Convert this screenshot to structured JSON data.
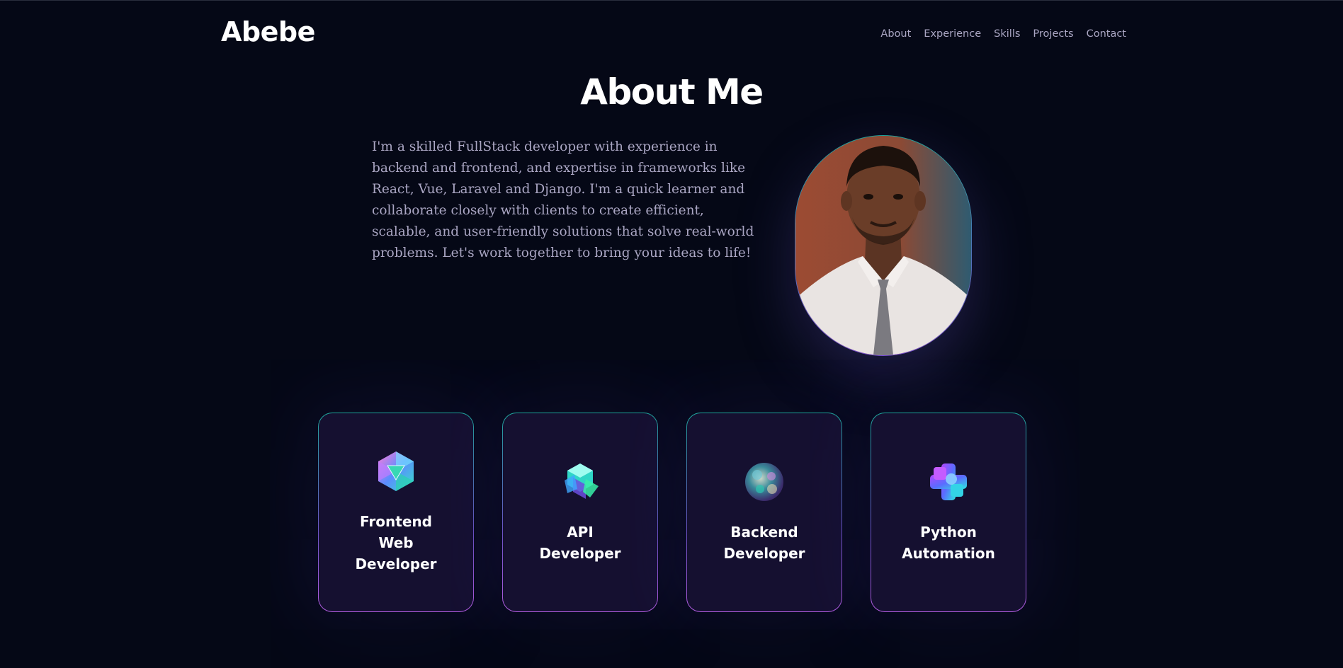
{
  "nav": {
    "logo": "Abebe",
    "links": [
      "About",
      "Experience",
      "Skills",
      "Projects",
      "Contact"
    ]
  },
  "about": {
    "title": "About Me",
    "text": "I'm a skilled FullStack developer with experience in backend and frontend, and expertise in frameworks like React, Vue, Laravel and Django. I'm a quick learner and collaborate closely with clients to create efficient, scalable, and user-friendly solutions that solve real-world problems. Let's work together to bring your ideas to life!"
  },
  "services": [
    {
      "title": "Frontend Web Developer",
      "icon": "crystal-icosahedron-icon"
    },
    {
      "title": "API Developer",
      "icon": "interlocked-cubes-icon"
    },
    {
      "title": "Backend Developer",
      "icon": "faceted-sphere-icon"
    },
    {
      "title": "Python Automation",
      "icon": "gradient-gear-icon"
    }
  ],
  "colors": {
    "background": "#050816",
    "secondary_text": "#aaa6c3",
    "card_bg": "#151030",
    "accent_teal": "#1ea49a",
    "accent_purple": "#b25ce0"
  }
}
